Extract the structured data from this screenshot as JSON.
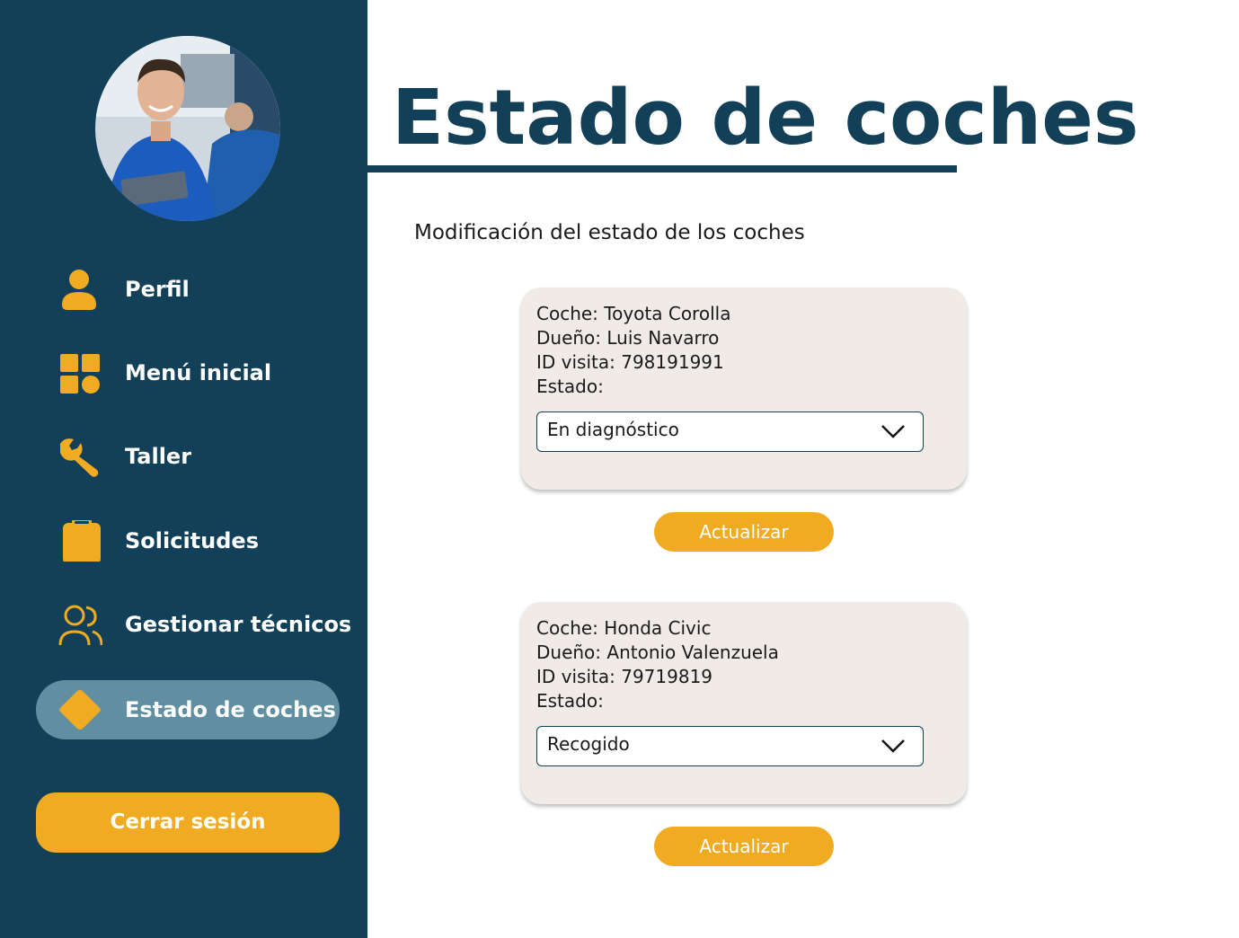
{
  "page": {
    "title": "Estado de coches",
    "subtitle": "Modificación del estado de los coches"
  },
  "sidebar": {
    "avatar_icon": "mechanic-photo",
    "items": [
      {
        "label": "Perfil",
        "icon": "user-icon"
      },
      {
        "label": "Menú inicial",
        "icon": "grid-icon"
      },
      {
        "label": "Taller",
        "icon": "wrench-icon"
      },
      {
        "label": "Solicitudes",
        "icon": "clipboard-icon"
      },
      {
        "label": "Gestionar técnicos",
        "icon": "users-icon"
      },
      {
        "label": "Estado de coches",
        "icon": "diamond-icon",
        "active": true
      }
    ],
    "logout_label": "Cerrar sesión"
  },
  "cars": [
    {
      "car": "Coche: Toyota Corolla",
      "owner": "Dueño: Luis Navarro",
      "visit_id": "ID visita: 798191991",
      "status_label": "Estado:",
      "status_value": "En diagnóstico",
      "button_label": "Actualizar"
    },
    {
      "car": "Coche: Honda Civic",
      "owner": "Dueño: Antonio Valenzuela",
      "visit_id": "ID visita: 79719819",
      "status_label": "Estado:",
      "status_value": "Recogido",
      "button_label": "Actualizar"
    }
  ],
  "colors": {
    "navy": "#114058",
    "accent": "#f0ab22",
    "active_bg": "#5f8fa1",
    "card_bg": "#f0ebe7"
  }
}
